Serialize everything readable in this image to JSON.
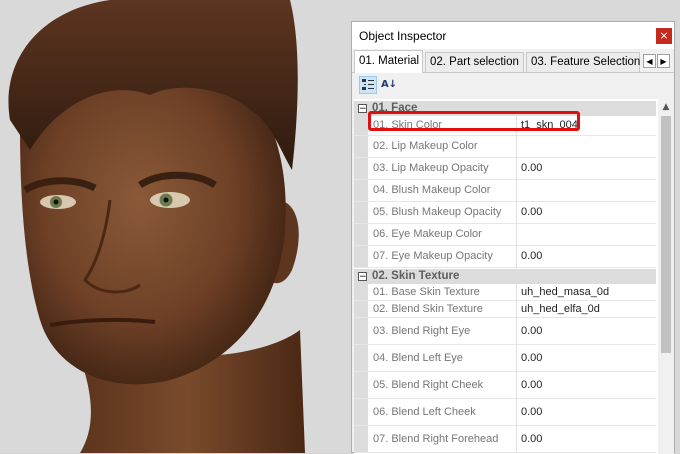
{
  "window": {
    "title": "Object Inspector",
    "close_glyph": "×"
  },
  "tabs": [
    {
      "label": "01. Material",
      "active": true
    },
    {
      "label": "02. Part selection",
      "active": false
    },
    {
      "label": "03. Feature Selection",
      "active": false
    }
  ],
  "tab_scroll": {
    "left_glyph": "◀",
    "right_glyph": "▶"
  },
  "toolbar": {
    "categorized_icon": "categorized-view-icon",
    "alphabetical_icon": "sort-alphabetical-icon",
    "alpha_label": "A↓"
  },
  "categories": [
    {
      "label": "01. Face",
      "toggle": "−",
      "properties": [
        {
          "name": "01. Skin Color",
          "value": "t1_skn_004"
        },
        {
          "name": "02. Lip Makeup Color",
          "value": ""
        },
        {
          "name": "03. Lip Makeup Opacity",
          "value": "0.00"
        },
        {
          "name": "04. Blush Makeup Color",
          "value": ""
        },
        {
          "name": "05. Blush Makeup Opacity",
          "value": "0.00"
        },
        {
          "name": "06. Eye Makeup Color",
          "value": ""
        },
        {
          "name": "07. Eye Makeup Opacity",
          "value": "0.00"
        }
      ]
    },
    {
      "label": "02. Skin Texture",
      "toggle": "−",
      "properties": [
        {
          "name": "01. Base Skin Texture",
          "value": "uh_hed_masa_0d"
        },
        {
          "name": "02. Blend Skin Texture",
          "value": "uh_hed_elfa_0d"
        },
        {
          "name": "03. Blend Right Eye",
          "value": "0.00"
        },
        {
          "name": "04. Blend Left Eye",
          "value": "0.00"
        },
        {
          "name": "05. Blend Right Cheek",
          "value": "0.00"
        },
        {
          "name": "06. Blend Left Cheek",
          "value": "0.00"
        },
        {
          "name": "07. Blend Right Forehead",
          "value": "0.00"
        }
      ]
    }
  ],
  "scrollbar": {
    "up_glyph": "▲"
  },
  "colors": {
    "highlight": "#e01010",
    "close_button": "#c42b1c",
    "category_bg": "#dcdcdc",
    "skin": "#7a4a2c",
    "hair": "#4a2a18"
  }
}
